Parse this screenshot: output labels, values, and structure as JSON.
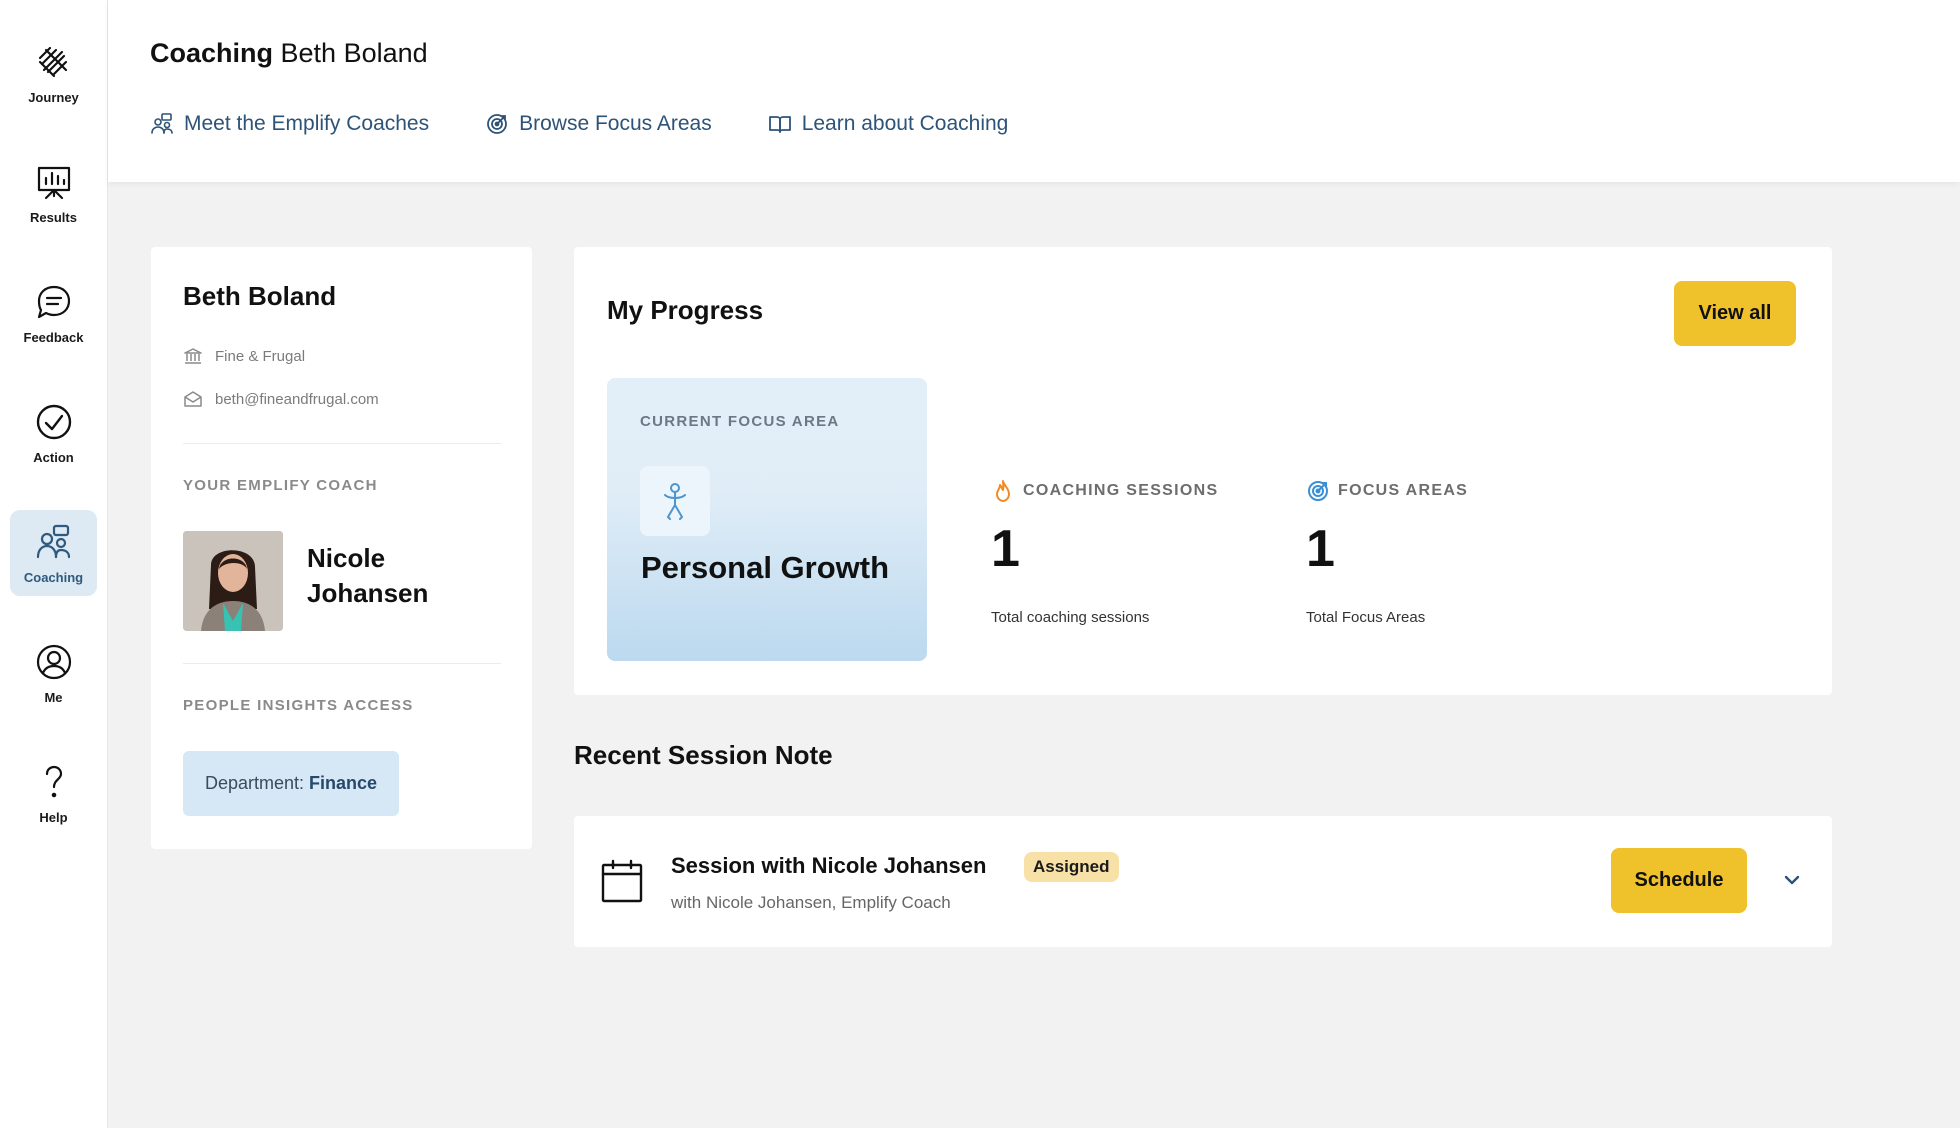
{
  "sidebar": {
    "items": [
      {
        "label": "Journey",
        "icon": "journey-icon"
      },
      {
        "label": "Results",
        "icon": "results-icon"
      },
      {
        "label": "Feedback",
        "icon": "feedback-icon"
      },
      {
        "label": "Action",
        "icon": "action-check-icon"
      },
      {
        "label": "Coaching",
        "icon": "coaching-icon",
        "active": true
      },
      {
        "label": "Me",
        "icon": "user-icon"
      },
      {
        "label": "Help",
        "icon": "help-question-icon"
      }
    ]
  },
  "header": {
    "title_bold": "Coaching",
    "title_name": "Beth Boland",
    "links": [
      {
        "label": "Meet the Emplify Coaches",
        "icon": "coaches-icon"
      },
      {
        "label": "Browse Focus Areas",
        "icon": "target-icon"
      },
      {
        "label": "Learn about Coaching",
        "icon": "book-icon"
      }
    ]
  },
  "profile": {
    "name": "Beth Boland",
    "company": "Fine & Frugal",
    "email": "beth@fineandfrugal.com",
    "coach_label": "YOUR EMPLIFY COACH",
    "coach_name": "Nicole Johansen",
    "access_label": "PEOPLE INSIGHTS ACCESS",
    "department_prefix": "Department:",
    "department_value": "Finance"
  },
  "progress": {
    "title": "My Progress",
    "view_all_label": "View all",
    "focus_label": "CURRENT FOCUS AREA",
    "focus_name": "Personal Growth",
    "stats": [
      {
        "label": "COACHING SESSIONS",
        "value": "1",
        "sub": "Total coaching sessions",
        "icon": "flame-icon",
        "color": "#f08a24"
      },
      {
        "label": "FOCUS AREAS",
        "value": "1",
        "sub": "Total Focus Areas",
        "icon": "target-icon",
        "color": "#3a8fd6"
      }
    ]
  },
  "recent": {
    "title": "Recent Session Note",
    "session_title": "Session with Nicole Johansen",
    "status": "Assigned",
    "subtitle": "with Nicole Johansen, Emplify Coach",
    "schedule_label": "Schedule"
  },
  "colors": {
    "accent_yellow": "#efc12b",
    "link_blue": "#2e5378",
    "active_nav_bg": "#dde9f3"
  }
}
